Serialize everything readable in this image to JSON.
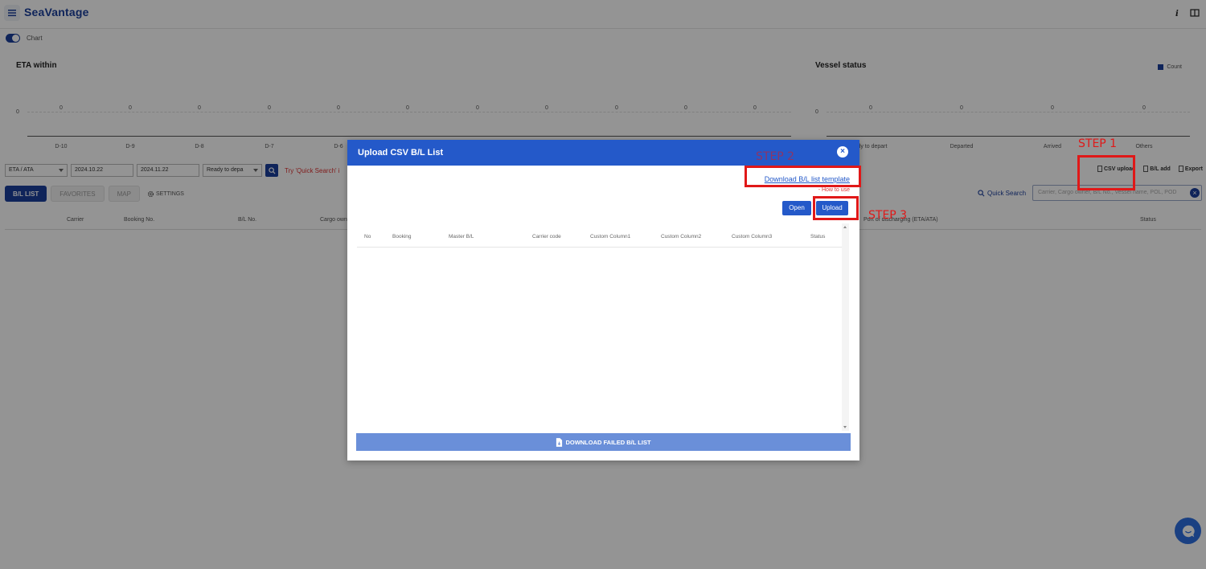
{
  "app": {
    "title": "SeaVantage"
  },
  "chart_toggle": {
    "label": "Chart"
  },
  "eta_chart": {
    "title": "ETA within",
    "zero_label": "0",
    "categories": [
      "D-10",
      "D-9",
      "D-8",
      "D-7",
      "D-6"
    ],
    "values": [
      "0",
      "0",
      "0",
      "0",
      "0",
      "0",
      "0",
      "0",
      "0",
      "0",
      "0"
    ]
  },
  "vessel_chart": {
    "title": "Vessel status",
    "legend": "Count",
    "zero_label": "0",
    "categories": [
      "ady to depart",
      "Departed",
      "Arrived",
      "Others"
    ],
    "values": [
      "0",
      "0",
      "0",
      "0"
    ]
  },
  "filters": {
    "mode": "ETA / ATA",
    "date_from": "2024.10.22",
    "date_to": "2024.11.22",
    "status": "Ready to depa",
    "hint": "Try 'Quick Search' i"
  },
  "actions": {
    "csv_upload": "CSV upload",
    "bl_add": "B/L add",
    "export": "Export"
  },
  "tabs": {
    "bl_list": "B/L LIST",
    "favorites": "FAVORITES",
    "map": "MAP",
    "settings": "SETTINGS"
  },
  "quick_search": {
    "label": "Quick Search",
    "placeholder": "Carrier, Cargo owner, B/L No., Vessel name, POL, POD"
  },
  "table": {
    "columns": [
      "Carrier",
      "Booking No.",
      "B/L No.",
      "Cargo own",
      "Port of discharging (ETA/ATA)",
      "Status"
    ]
  },
  "modal": {
    "title": "Upload CSV B/L List",
    "template_link": "Download B/L list template",
    "how_to_use": "- How to use",
    "open_button": "Open",
    "upload_button": "Upload",
    "columns": [
      "No",
      "Booking",
      "Master B/L",
      "Carrier code",
      "Custom Column1",
      "Custom Column2",
      "Custom Column3",
      "Status"
    ],
    "download_failed": "DOWNLOAD FAILED B/L LIST"
  },
  "annotations": {
    "step1": "STEP 1",
    "step2": "STEP 2",
    "step3": "STEP 3",
    "color": "#e01818"
  },
  "colors": {
    "brand": "#1b3f9c",
    "modal_header": "#2459c9",
    "hint_red": "#dd3333"
  }
}
